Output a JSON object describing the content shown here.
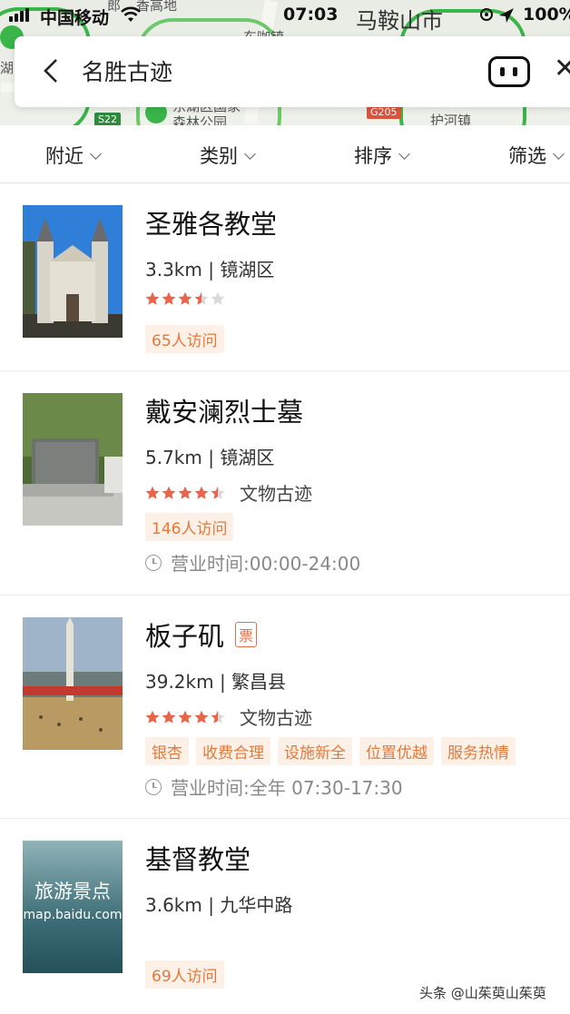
{
  "status_bar": {
    "carrier": "中国移动",
    "time": "07:03",
    "city": "马鞍山市",
    "battery": "100%"
  },
  "map": {
    "labels": [
      "郎",
      "香高地",
      "湖",
      "东咖镇",
      "东湖区国家",
      "森林公园",
      "护河镇"
    ],
    "badges": [
      "S22",
      "G205"
    ]
  },
  "search": {
    "query": "名胜古迹"
  },
  "filters": [
    "附近",
    "类别",
    "排序",
    "筛选"
  ],
  "results": [
    {
      "name": "圣雅各教堂",
      "meta": "3.3km | 镜湖区",
      "rating": 3.5,
      "category": "",
      "tags": [
        "65人访问"
      ],
      "hours": "",
      "ticket": ""
    },
    {
      "name": "戴安澜烈士墓",
      "meta": "5.7km | 镜湖区",
      "rating": 4.5,
      "category": "文物古迹",
      "tags": [
        "146人访问"
      ],
      "hours": "营业时间:00:00-24:00",
      "ticket": ""
    },
    {
      "name": "板子矶",
      "meta": "39.2km | 繁昌县",
      "rating": 4.5,
      "category": "文物古迹",
      "tags": [
        "银杏",
        "收费合理",
        "设施新全",
        "位置优越",
        "服务热情"
      ],
      "hours": "营业时间:全年 07:30-17:30",
      "ticket": "票"
    },
    {
      "name": "基督教堂",
      "meta": "3.6km | 九华中路",
      "rating": 0,
      "category": "",
      "tags": [
        "69人访问"
      ],
      "hours": "",
      "ticket": "",
      "thumb_text": "旅游景点",
      "thumb_subtext": "map.baidu.com"
    }
  ],
  "watermark": "头条 @山茱萸山茱萸",
  "colors": {
    "star": "#e8644a",
    "star_empty": "#d9d9d9",
    "tag_bg": "#fdf1e7",
    "tag_text": "#e2793a",
    "map_green": "#39b54a"
  }
}
